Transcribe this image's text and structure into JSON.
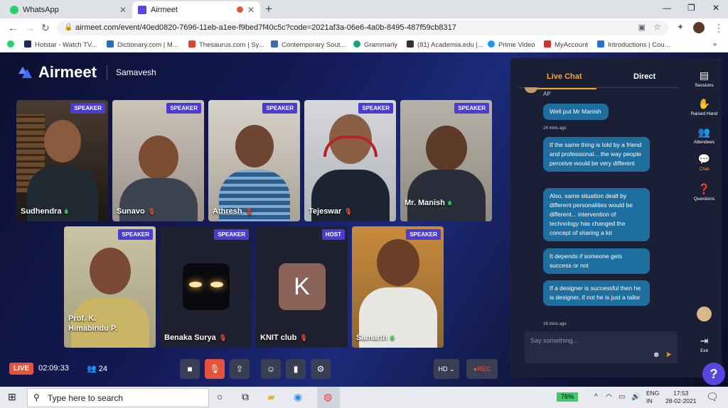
{
  "browser": {
    "tabs": [
      {
        "label": "WhatsApp",
        "icon": "whatsapp-icon"
      },
      {
        "label": "Airmeet",
        "icon": "airmeet-icon"
      }
    ],
    "url": "airmeet.com/event/40ed0820-7696-11eb-a1ee-f9bed7f40c5c?code=2021af3a-06e6-4a0b-8495-487f59cb8317",
    "bookmarks": [
      "Hotstar - Watch TV...",
      "Dictionary.com | M...",
      "Thesaurus.com | Sy...",
      "Contemporary Sout...",
      "Grammarly",
      "(81) Academia.edu |...",
      "Prime Video",
      "MyAccount",
      "Introductions | Cou..."
    ]
  },
  "app": {
    "brand": "Airmeet",
    "event_name": "Samavesh",
    "participants": [
      {
        "name": "Sudhendra",
        "role": "SPEAKER",
        "audio": "speaking"
      },
      {
        "name": "Sunavo",
        "role": "SPEAKER",
        "audio": "muted"
      },
      {
        "name": "Athresh",
        "role": "SPEAKER",
        "audio": "muted"
      },
      {
        "name": "Tejeswar",
        "role": "SPEAKER",
        "audio": "muted"
      },
      {
        "name": "Mr. Manish",
        "role": "SPEAKER",
        "audio": "speaking"
      },
      {
        "name": "Prof. K. Himabindu P.",
        "role": "SPEAKER",
        "audio": "muted"
      },
      {
        "name": "Benaka Surya",
        "role": "SPEAKER",
        "audio": "muted"
      },
      {
        "name": "KNIT club",
        "role": "HOST",
        "audio": "muted",
        "avatar_letter": "K"
      },
      {
        "name": "Samarth",
        "role": "SPEAKER",
        "audio": "speaking"
      }
    ],
    "status": {
      "live": "LIVE",
      "timer": "02:09:33",
      "attendees": "24"
    },
    "controls": {
      "hd": "HD",
      "rec": "REC"
    }
  },
  "chat": {
    "tabs": {
      "live": "Live Chat",
      "direct": "Direct"
    },
    "partial_author": "AP",
    "messages": [
      {
        "text": "Well put Mr Manish",
        "time": "24 mins ago"
      },
      {
        "text": "If the same thing is told by a friend and professional... the way people perceive would be very different"
      },
      {
        "text": "Also, same situation dealt by different personalities would be different... intervention of technology has changed the concept of sharing a lot"
      },
      {
        "text": "It depends if someone gets success or not"
      },
      {
        "text": "If a designer is successful then he is designer, if not he is just a tailor",
        "time": "16 mins ago"
      }
    ],
    "placeholder": "Say something..."
  },
  "rail": [
    "Sessions",
    "Raised Hand",
    "Attendees",
    "Chat",
    "Questions",
    "Exit"
  ],
  "taskbar": {
    "search_placeholder": "Type here to search",
    "battery": "76%",
    "lang": [
      "ENG",
      "IN"
    ],
    "time": "17:53",
    "date": "28-02-2021"
  },
  "colors": {
    "accent": "#f5a623",
    "badge": "#4b3cd8",
    "live": "#e5533d",
    "bubble": "#1e6f9f"
  }
}
